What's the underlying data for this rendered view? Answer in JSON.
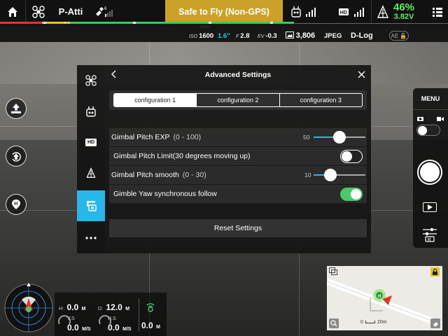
{
  "top_bar": {
    "flight_mode": "P-Atti",
    "status": "Safe to Fly (Non-GPS)",
    "battery_percent": "46%",
    "battery_voltage": "3.82V",
    "hd_label": "HD",
    "home_altitude": "--:--"
  },
  "camera_info": {
    "iso_label": "ISO",
    "iso_value": "1600",
    "shutter": "1.6\"",
    "aperture_label": "F",
    "aperture_value": "2.8",
    "ev_label": "EV",
    "ev_value": "-0.3",
    "remaining_shots": "3,806",
    "format": "JPEG",
    "color_profile": "D-Log",
    "ae_lock": "AE"
  },
  "right_panel": {
    "menu_label": "MENU"
  },
  "sidebar": {
    "items": [
      {
        "icon": "aircraft-icon"
      },
      {
        "icon": "remote-controller-icon"
      },
      {
        "icon": "hd-link-icon",
        "label": "HD"
      },
      {
        "icon": "battery-icon"
      },
      {
        "icon": "gimbal-icon"
      },
      {
        "icon": "more-icon"
      }
    ],
    "active_index": 4
  },
  "dialog": {
    "title": "Advanced Settings",
    "tabs": [
      "configuration 1",
      "configuration 2",
      "configuration 3"
    ],
    "active_tab": 0,
    "rows": [
      {
        "label": "Gimbal Pitch EXP",
        "range": "(0 - 100)",
        "value": "50",
        "value_fraction": 0.5
      },
      {
        "label": "Gimbal Pitch Limit(30 degrees moving up)",
        "toggle": false
      },
      {
        "label": "Gimbal Pitch smooth",
        "range": "(0 - 30)",
        "value": "10",
        "value_fraction": 0.33
      },
      {
        "label": "Gimble Yaw synchronous follow",
        "toggle": true
      }
    ],
    "reset_label": "Reset Settings"
  },
  "telemetry": {
    "h_label": "H:",
    "h_value": "0.0",
    "h_unit": "M",
    "d_label": "D:",
    "d_value": "12.0",
    "d_unit": "M",
    "vs_label": "V.S",
    "vs_value": "0.0",
    "vs_unit": "M/S",
    "hs_label": "H.S",
    "hs_value": "0.0",
    "hs_unit": "M/S",
    "vps_value": "0.0",
    "vps_unit": "M"
  },
  "map": {
    "scale_start": "0",
    "scale_end": "20m",
    "home_marker": "H"
  },
  "colors": {
    "accent": "#29b6e8",
    "status": "#c9a227",
    "battery": "#5ff05f",
    "toggle_on": "#4cc76b"
  }
}
